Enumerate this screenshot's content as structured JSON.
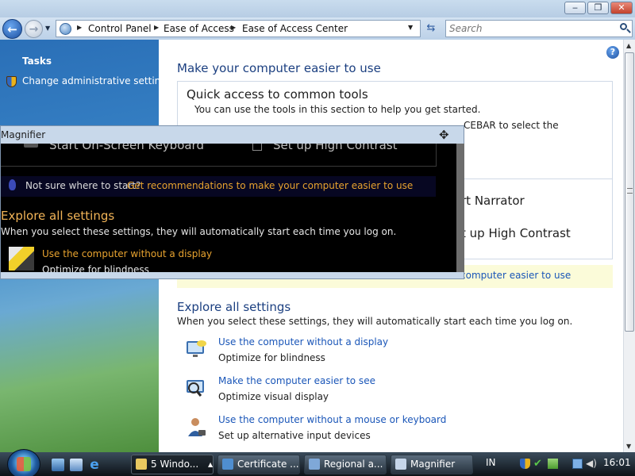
{
  "window": {
    "minimize_glyph": "‒",
    "maximize_glyph": "❐",
    "close_glyph": "✕"
  },
  "navbar": {
    "breadcrumb": [
      "Control Panel",
      "Ease of Access",
      "Ease of Access Center"
    ],
    "search_placeholder": "Search",
    "icons": [
      "back-arrow-icon",
      "forward-arrow-icon",
      "control-panel-icon",
      "refresh-icon",
      "search-icon"
    ]
  },
  "sidebar": {
    "title": "Tasks",
    "items": [
      {
        "label": "Change administrative settings",
        "icon": "uac-shield-icon"
      }
    ]
  },
  "main": {
    "title": "Make your computer easier to use",
    "quick_access": {
      "heading": "Quick access to common tools",
      "description": "You can use the tools in this section to help you get started.",
      "instruction_fragment": "CEBAR to select the",
      "tool_fragments": [
        "rt Narrator",
        "t up High Contrast"
      ]
    },
    "recommendation_fragment": "computer easier to use",
    "explore": {
      "heading": "Explore all settings",
      "description": "When you select these settings, they will automatically start each time you log on.",
      "items": [
        {
          "title": "Use the computer without a display",
          "desc": "Optimize for blindness",
          "icon": "display-settings-icon"
        },
        {
          "title": "Make the computer easier to see",
          "desc": "Optimize visual display",
          "icon": "magnifier-display-icon"
        },
        {
          "title": "Use the computer without a mouse or keyboard",
          "desc": "Set up alternative input devices",
          "icon": "user-input-icon"
        }
      ]
    },
    "help_glyph": "?"
  },
  "magnifier": {
    "title": "Magnifier",
    "top_tools": [
      "Start On-Screen Keyboard",
      "Set up High Contrast"
    ],
    "rec_prompt": "Not sure where to start?",
    "rec_link": "Get recommendations to make your computer easier to use",
    "explore_heading": "Explore all settings",
    "explore_desc": "When you select these settings, they will automatically start each time you log on.",
    "setting_title": "Use the computer without a display",
    "setting_desc": "Optimize for blindness"
  },
  "taskbar": {
    "tasks": [
      {
        "label": "5 Windo...",
        "active": true
      },
      {
        "label": "Certificate ...",
        "active": false
      },
      {
        "label": "Regional a...",
        "active": false
      },
      {
        "label": "Magnifier",
        "active": false
      }
    ],
    "language": "IN",
    "clock": "16:01",
    "quick_launch": [
      "show-desktop-icon",
      "switch-windows-icon",
      "internet-explorer-icon"
    ],
    "tray_icons": [
      "security-shield-icon",
      "checkmark-icon",
      "network-icon",
      "display-icon",
      "speaker-icon"
    ]
  },
  "colors": {
    "link": "#1a56b8",
    "heading": "#1b3f80",
    "magnifier_link": "#e8a32f",
    "magnifier_heading": "#f2b457"
  }
}
